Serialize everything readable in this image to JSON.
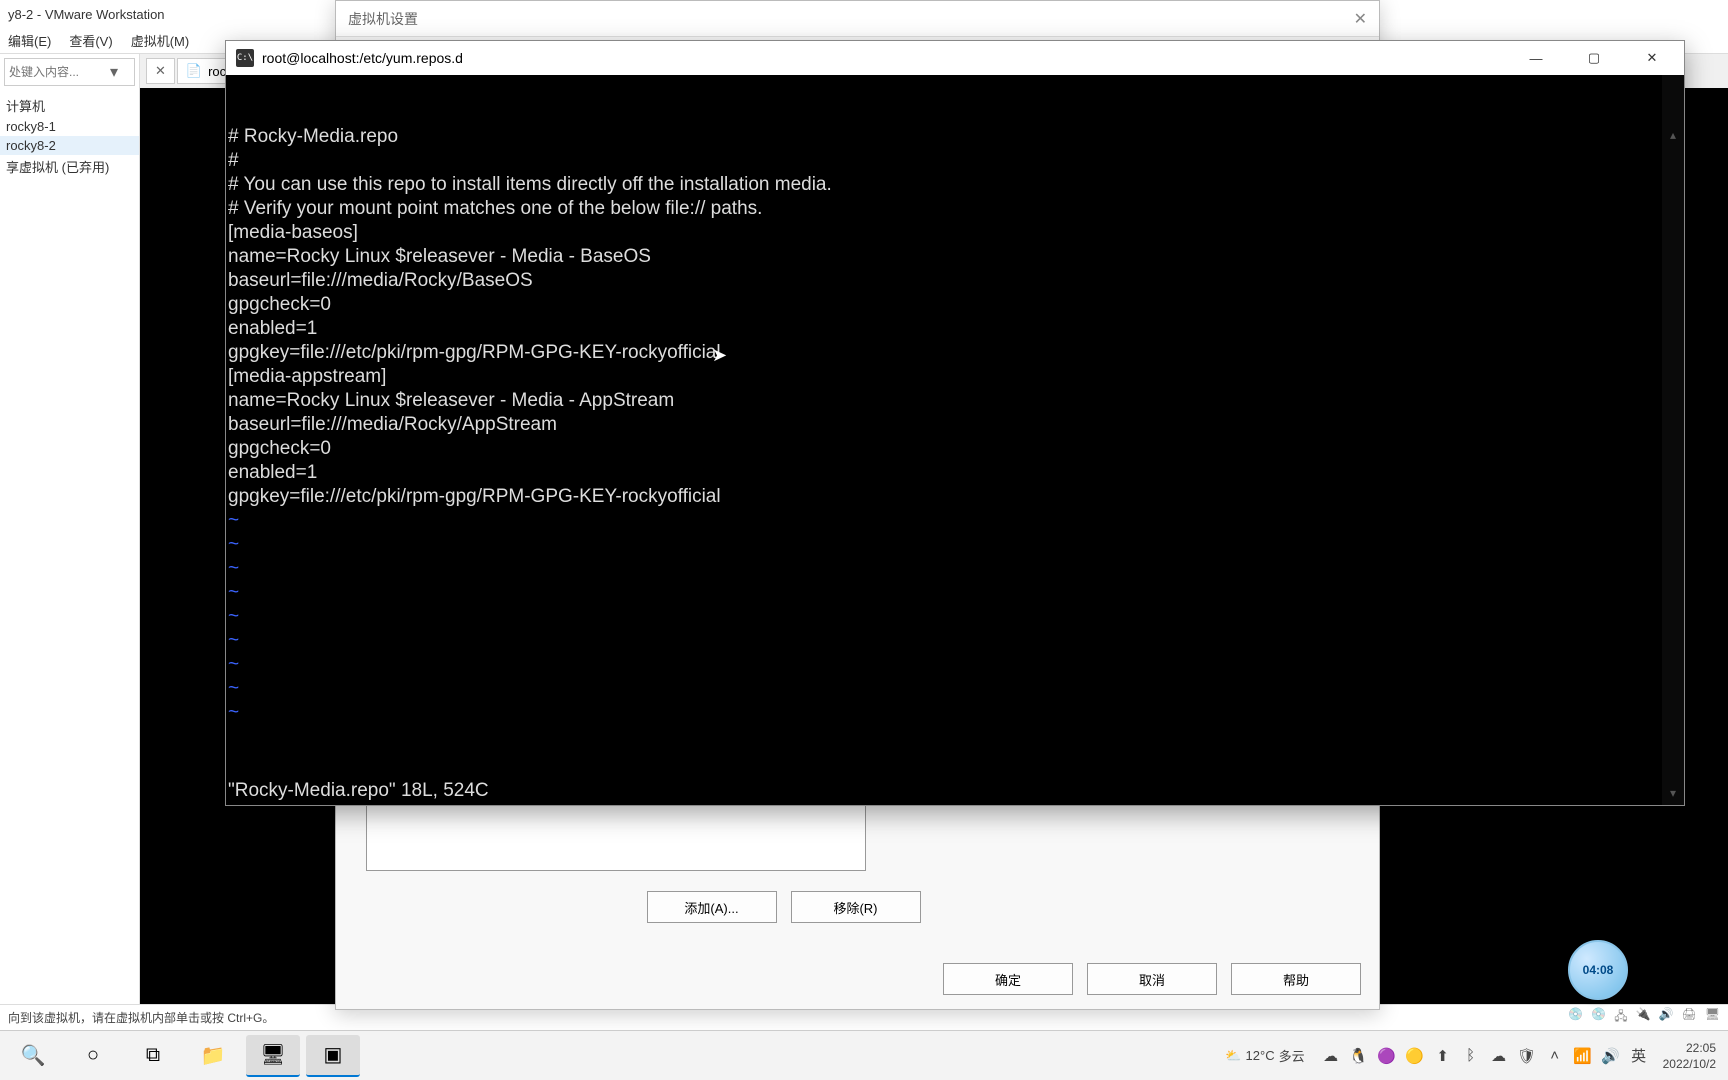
{
  "vmware": {
    "title": "y8-2 - VMware Workstation",
    "menu": {
      "edit": "编辑(E)",
      "view": "查看(V)",
      "vm": "虚拟机(M)"
    },
    "sidebar": {
      "placeholder": "处键入内容...",
      "items": [
        "计算机",
        "rocky8-1",
        "rocky8-2",
        "享虚拟机 (已弃用)"
      ],
      "selected_index": 2,
      "tab1": "rock",
      "tab1_icon": "📄"
    },
    "status_left": "向到该虚拟机，请在虚拟机内部单击或按 Ctrl+G。"
  },
  "vm_settings": {
    "title": "虚拟机设置",
    "buttons": {
      "add": "添加(A)...",
      "remove": "移除(R)",
      "ok": "确定",
      "cancel": "取消",
      "help": "帮助"
    }
  },
  "terminal": {
    "title": "root@localhost:/etc/yum.repos.d",
    "icon_text": "C:\\",
    "file": {
      "header": [
        "# Rocky-Media.repo",
        "#",
        "# You can use this repo to install items directly off the installation media.",
        "# Verify your mount point matches one of the below file:// paths.",
        ""
      ],
      "sections": [
        {
          "id": "[media-baseos]",
          "lines": [
            "name=Rocky Linux $releasever - Media - BaseOS",
            "baseurl=file:///media/Rocky/BaseOS",
            "gpgcheck=0",
            "enabled=1",
            "gpgkey=file:///etc/pki/rpm-gpg/RPM-GPG-KEY-rockyofficial"
          ]
        },
        {
          "id": "[media-appstream]",
          "lines": [
            "name=Rocky Linux $releasever - Media - AppStream",
            "baseurl=file:///media/Rocky/AppStream",
            "gpgcheck=0",
            "enabled=1",
            "gpgkey=file:///etc/pki/rpm-gpg/RPM-GPG-KEY-rockyofficial"
          ]
        }
      ],
      "tildes": 9,
      "status": "\"Rocky-Media.repo\" 18L, 524C"
    },
    "ctrl": {
      "min": "—",
      "max": "▢",
      "close": "✕"
    }
  },
  "taskbar": {
    "weather": {
      "icon": "⛅",
      "temp": "12°C",
      "desc": "多云"
    },
    "ime": "英",
    "clock_time": "22:05",
    "clock_date": "2022/10/2"
  },
  "timer": "04:08"
}
